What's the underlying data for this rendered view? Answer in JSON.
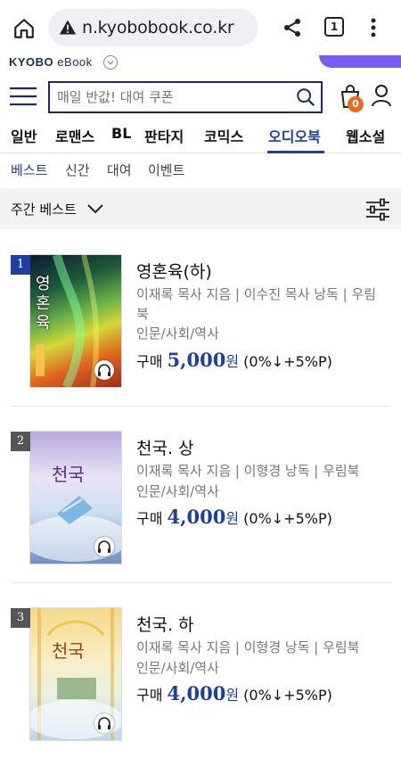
{
  "browser": {
    "url": "n.kyobobook.co.kr",
    "tab_count": "1"
  },
  "header": {
    "logo_brand": "KYOBO",
    "logo_suffix": "eBook",
    "search_placeholder": "매일 반값! 대여 쿠폰",
    "cart_count": "0",
    "accent_color": "#1c3fa0",
    "badge_color": "#ea6b1a"
  },
  "category_tabs": [
    {
      "label": "일반"
    },
    {
      "label": "로맨스"
    },
    {
      "label": "BL"
    },
    {
      "label": "판타지"
    },
    {
      "label": "코믹스"
    },
    {
      "label": "오디오북",
      "active": true
    },
    {
      "label": "웹소설"
    }
  ],
  "sub_tabs": [
    {
      "label": "베스트",
      "active": true
    },
    {
      "label": "신간"
    },
    {
      "label": "대여"
    },
    {
      "label": "이벤트"
    }
  ],
  "filter": {
    "label": "주간 베스트"
  },
  "books": [
    {
      "rank": "1",
      "title": "영혼육(하)",
      "meta": "이재록 목사 지음 | 이수진 목사 낭독 | 우림북",
      "category": "인문/사회/역사",
      "price_label": "구매",
      "price": "5,000",
      "price_unit": "원",
      "price_extra": "(0%↓+5%P)",
      "cover_title": "영혼육",
      "rank_color": "#1c3fa0"
    },
    {
      "rank": "2",
      "title": "천국. 상",
      "meta": "이재록 목사 지음 | 이형경 낭독 | 우림북",
      "category": "인문/사회/역사",
      "price_label": "구매",
      "price": "4,000",
      "price_unit": "원",
      "price_extra": "(0%↓+5%P)",
      "cover_title": "천국",
      "rank_color": "#555555"
    },
    {
      "rank": "3",
      "title": "천국. 하",
      "meta": "이재록 목사 지음 | 이형경 낭독 | 우림북",
      "category": "인문/사회/역사",
      "price_label": "구매",
      "price": "4,000",
      "price_unit": "원",
      "price_extra": "(0%↓+5%P)",
      "cover_title": "천국",
      "rank_color": "#555555"
    }
  ]
}
